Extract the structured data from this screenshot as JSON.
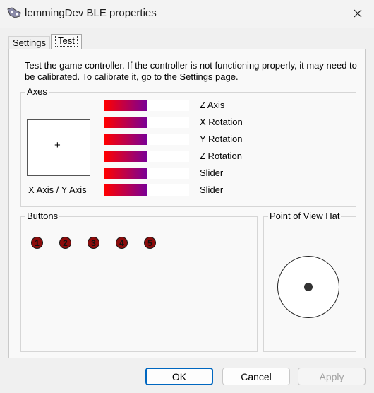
{
  "window": {
    "title": "lemmingDev BLE properties"
  },
  "tabs": [
    {
      "label": "Settings",
      "active": false
    },
    {
      "label": "Test",
      "active": true
    }
  ],
  "intro_text": "Test the game controller.  If the controller is not functioning properly, it may need to be calibrated.  To calibrate it, go to the Settings page.",
  "axes": {
    "label": "Axes",
    "xy_label": "X Axis / Y Axis",
    "xy_marker": "+",
    "bars": [
      {
        "label": "Z Axis",
        "fill_percent": 50
      },
      {
        "label": "X Rotation",
        "fill_percent": 50
      },
      {
        "label": "Y Rotation",
        "fill_percent": 50
      },
      {
        "label": "Z Rotation",
        "fill_percent": 50
      },
      {
        "label": "Slider",
        "fill_percent": 50
      },
      {
        "label": "Slider",
        "fill_percent": 50
      }
    ]
  },
  "buttons_group": {
    "label": "Buttons",
    "buttons": [
      "1",
      "2",
      "3",
      "4",
      "5"
    ]
  },
  "pov": {
    "label": "Point of View Hat"
  },
  "footer": {
    "ok": "OK",
    "cancel": "Cancel",
    "apply": "Apply"
  },
  "colors": {
    "accent": "#0067c0",
    "bar_start": "#ff0000",
    "bar_end": "#7a0096",
    "button_fill": "#8b0b0b"
  }
}
